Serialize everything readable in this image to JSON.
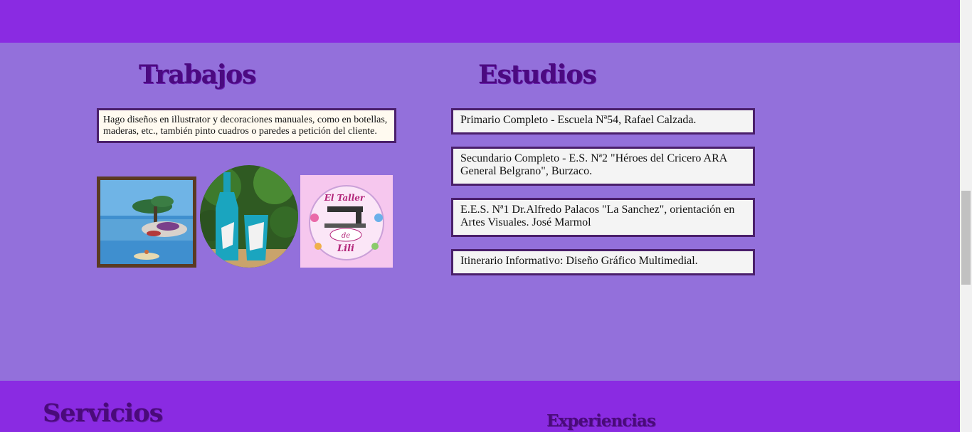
{
  "sections": {
    "trabajos": {
      "title": "Trabajos",
      "description": "Hago diseños en illustrator y decoraciones manuales, como en botellas, maderas, etc., también pinto cuadros o paredes a petición del cliente.",
      "images": [
        {
          "alt": "painting-floating-tree"
        },
        {
          "alt": "painted-bottles-CAT"
        },
        {
          "alt": "el-taller-de-lili-logo",
          "logo_text": [
            "El Taller",
            "de",
            "Lili"
          ]
        }
      ]
    },
    "estudios": {
      "title": "Estudios",
      "items": [
        "Primario Completo - Escuela Nª54, Rafael Calzada.",
        "Secundario Completo - E.S. Nª2 \"Héroes del Cricero ARA General Belgrano\", Burzaco.",
        "E.E.S. Nª1 Dr.Alfredo Palacos \"La Sanchez\", orientación en Artes Visuales. José Marmol",
        "Itinerario Informativo: Diseño Gráfico Multimedial."
      ]
    },
    "servicios": {
      "title": "Servicios"
    },
    "experiencias": {
      "title": "Experiencias"
    }
  },
  "colors": {
    "band_dark": "#8a2be2",
    "band_light": "#9370db",
    "heading": "#4b0a80",
    "box_border": "#4a1f6b"
  }
}
